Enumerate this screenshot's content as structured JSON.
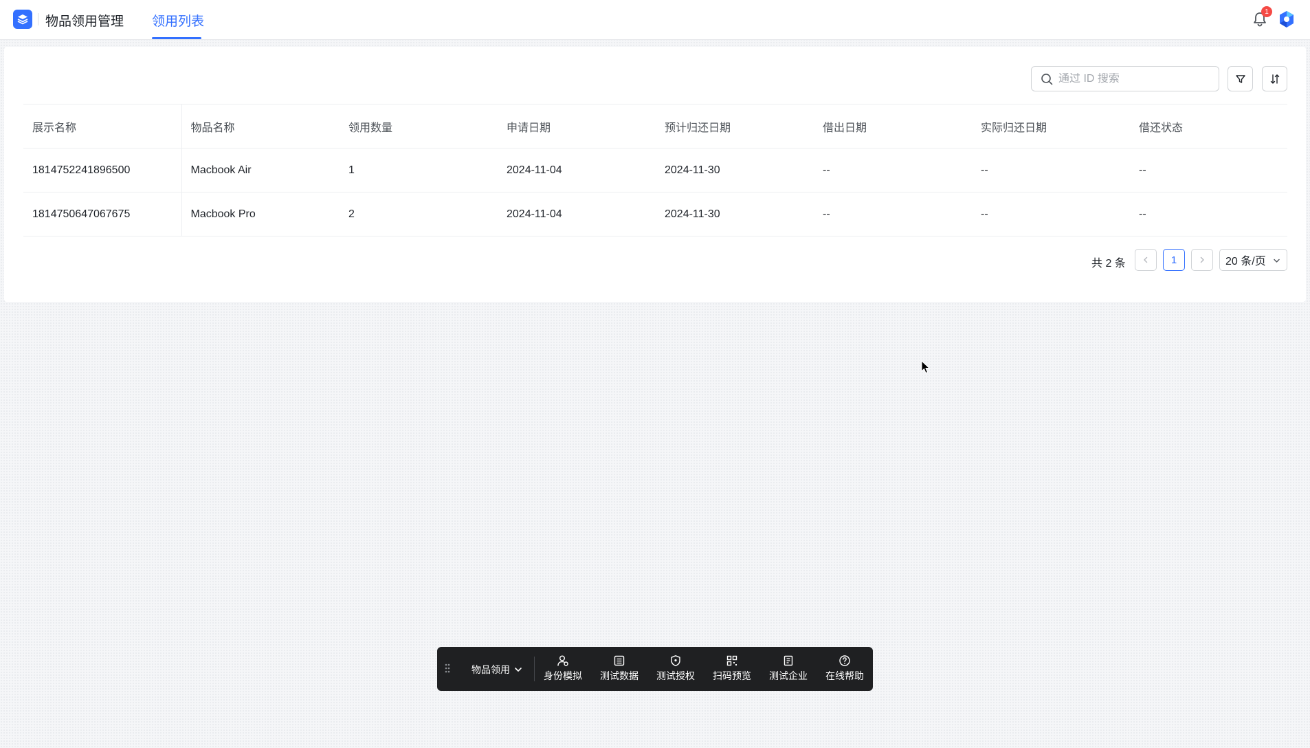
{
  "header": {
    "app_title": "物品领用管理",
    "tab_label": "领用列表",
    "notification_count": "1"
  },
  "toolbar": {
    "search_placeholder": "通过 ID 搜索"
  },
  "table": {
    "columns": [
      "展示名称",
      "物品名称",
      "领用数量",
      "申请日期",
      "预计归还日期",
      "借出日期",
      "实际归还日期",
      "借还状态"
    ],
    "rows": [
      [
        "1814752241896500",
        "Macbook Air",
        "1",
        "2024-11-04",
        "2024-11-30",
        "--",
        "--",
        "--"
      ],
      [
        "1814750647067675",
        "Macbook Pro",
        "2",
        "2024-11-04",
        "2024-11-30",
        "--",
        "--",
        "--"
      ]
    ]
  },
  "pagination": {
    "total_text": "共 2 条",
    "current_page": "1",
    "page_size": "20 条/页"
  },
  "dock": {
    "scope_label": "物品领用",
    "items": [
      "身份模拟",
      "测试数据",
      "测试授权",
      "扫码预览",
      "测试企业",
      "在线帮助"
    ]
  },
  "colors": {
    "accent": "#3370ff",
    "badge": "#f54a45",
    "dock_bg": "#1f2022"
  }
}
